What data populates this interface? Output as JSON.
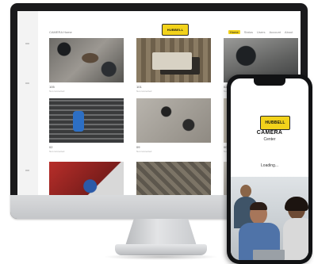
{
  "desktop": {
    "app_title": "CAMERA Home",
    "logo_text": "HUBBELL",
    "nav": [
      "Home",
      "Status",
      "Users",
      "Account",
      "About"
    ],
    "tiles": [
      {
        "name": "105",
        "status": "Not connected"
      },
      {
        "name": "101",
        "status": "Not connected"
      },
      {
        "name": "02",
        "status": "Not connected"
      },
      {
        "name": "02",
        "status": "Not connected"
      },
      {
        "name": "09",
        "status": "Not connected"
      },
      {
        "name": "001",
        "status": "Not connected"
      }
    ]
  },
  "mobile": {
    "logo_text": "HUBBELL",
    "title": "CAMERA",
    "subtitle": "Center",
    "loading": "Loading..."
  },
  "colors": {
    "accent": "#f2d21b",
    "bezel": "#1a1a1c"
  }
}
